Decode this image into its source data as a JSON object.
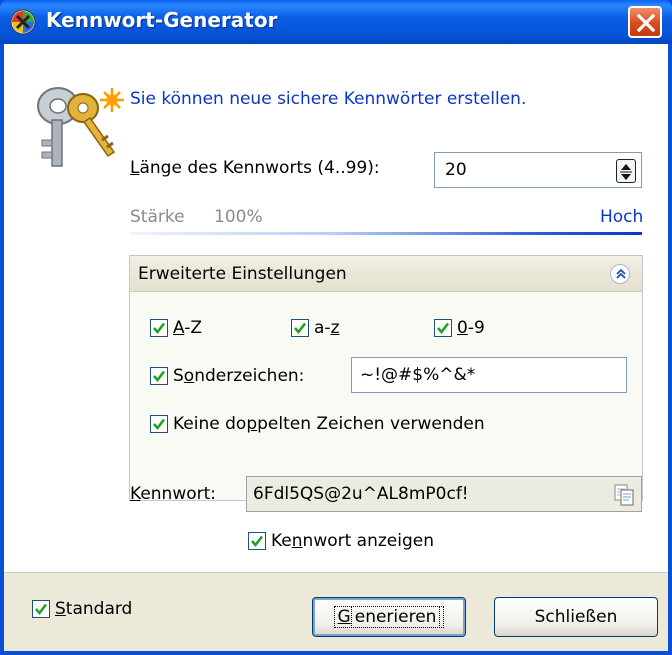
{
  "window": {
    "title": "Kennwort-Generator",
    "close_label": "close"
  },
  "intro": {
    "text": "Sie können neue sichere Kennwörter erstellen."
  },
  "length": {
    "label_pre": "",
    "label_u": "L",
    "label_post": "änge des Kennworts (4..99):",
    "value": "20"
  },
  "strength": {
    "label": "Stärke",
    "value": "100%",
    "level": "Hoch",
    "fraction": 1.0
  },
  "advanced": {
    "title": "Erweiterte Einstellungen",
    "az_upper": {
      "u": "A",
      "rest": "-Z",
      "checked": true
    },
    "az_lower": {
      "pre": "a-",
      "u": "z",
      "checked": true
    },
    "digits": {
      "u": "0",
      "rest": "-9",
      "checked": true
    },
    "special": {
      "pre": "S",
      "u": "o",
      "rest": "nderzeichen:",
      "checked": true,
      "value": "~!@#$%^&*"
    },
    "no_duplicates": {
      "pre": "Keine do",
      "u": "p",
      "rest": "pelten Zeichen verwenden",
      "checked": true
    }
  },
  "password": {
    "label_u": "K",
    "label_rest": "ennwort:",
    "value": "6Fdl5QS@2u^AL8mP0cf!",
    "show_pre": "Ke",
    "show_u": "n",
    "show_rest": "nwort anzeigen",
    "show_checked": true
  },
  "footer": {
    "standard_u": "S",
    "standard_rest": "tandard",
    "standard_checked": true,
    "generate_u": "G",
    "generate_rest": "enerieren",
    "close_label": "Schließen"
  },
  "colors": {
    "title_blue": "#0a5ee6",
    "link_blue": "#0a36c8",
    "close_red": "#d84a1e"
  },
  "icons": [
    "app-icon",
    "keys-icon",
    "close-icon",
    "spinner-icon",
    "collapse-chevron-icon",
    "checkbox-check-icon",
    "copy-icon"
  ]
}
